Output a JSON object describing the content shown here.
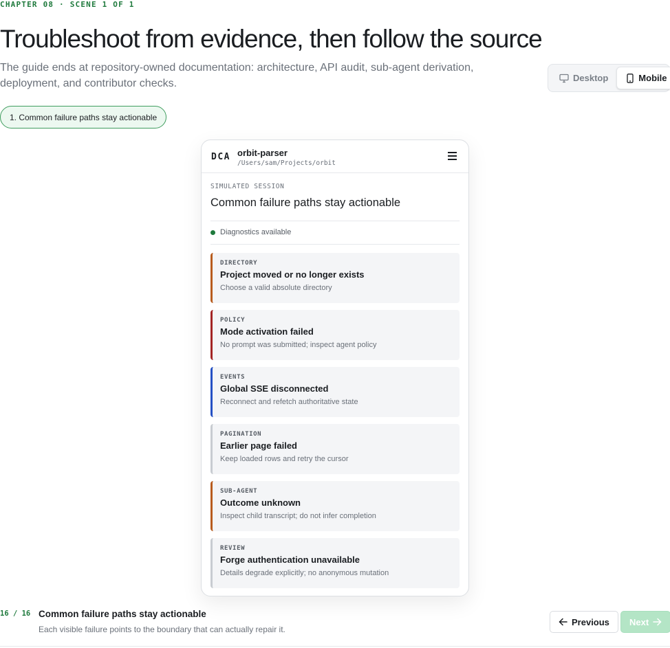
{
  "chapter": "CHAPTER 08 · SCENE 1 OF 1",
  "title": "Troubleshoot from evidence, then follow the source",
  "subtitle": "The guide ends at repository-owned documentation: architecture, API audit, sub-agent derivation, deployment, and contributor checks.",
  "view_toggle": {
    "desktop_label": "Desktop",
    "mobile_label": "Mobile",
    "selected": "Mobile"
  },
  "step_pill": "1. Common failure paths stay actionable",
  "phone": {
    "logo": "DCA",
    "project_name": "orbit-parser",
    "project_path": "/Users/sam/Projects/orbit",
    "menu_icon": "hamburger-icon",
    "sim_label": "SIMULATED SESSION",
    "session_title": "Common failure paths stay actionable",
    "status_text": "Diagnostics available",
    "status_color": "#1f7a3d",
    "cards": [
      {
        "category": "DIRECTORY",
        "title": "Project moved or no longer exists",
        "desc": "Choose a valid absolute directory",
        "accent": "#b85c1e"
      },
      {
        "category": "POLICY",
        "title": "Mode activation failed",
        "desc": "No prompt was submitted; inspect agent policy",
        "accent": "#a32424"
      },
      {
        "category": "EVENTS",
        "title": "Global SSE disconnected",
        "desc": "Reconnect and refetch authoritative state",
        "accent": "#2450c4"
      },
      {
        "category": "PAGINATION",
        "title": "Earlier page failed",
        "desc": "Keep loaded rows and retry the cursor",
        "accent": "#c8ccd1"
      },
      {
        "category": "SUB-AGENT",
        "title": "Outcome unknown",
        "desc": "Inspect child transcript; do not infer completion",
        "accent": "#b85c1e"
      },
      {
        "category": "REVIEW",
        "title": "Forge authentication unavailable",
        "desc": "Details degrade explicitly; no anonymous mutation",
        "accent": "#c8ccd1"
      }
    ]
  },
  "footer": {
    "step": "16 / 16",
    "title": "Common failure paths stay actionable",
    "desc": "Each visible failure points to the boundary that can actually repair it.",
    "prev_label": "Previous",
    "next_label": "Next"
  }
}
